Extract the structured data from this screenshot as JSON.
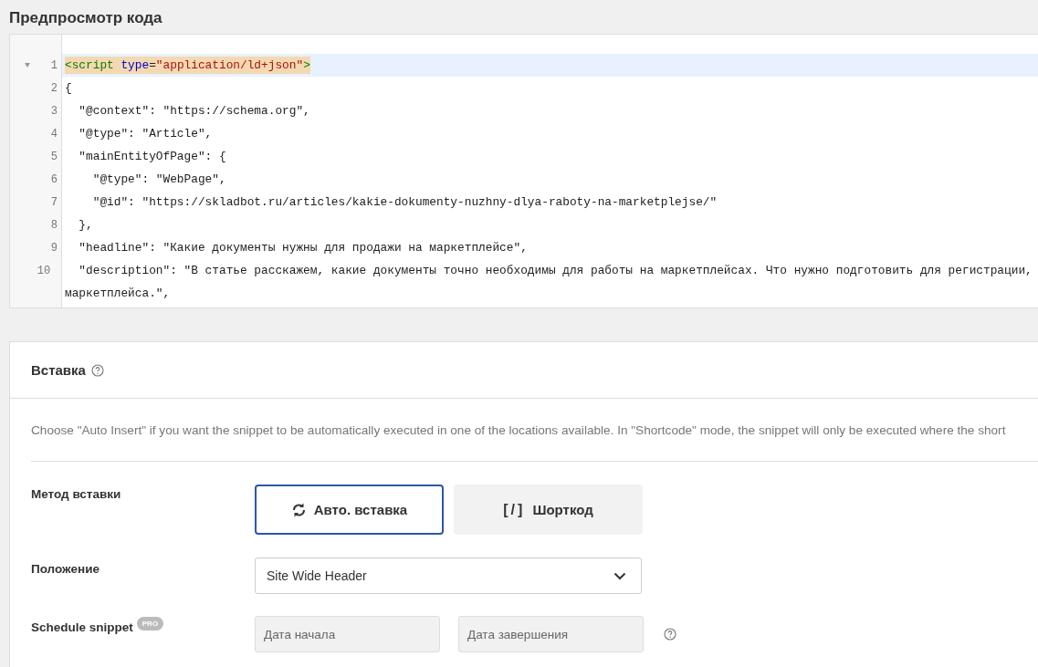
{
  "preview": {
    "title": "Предпросмотр кода",
    "lines": [
      {
        "number": "1",
        "foldable": true,
        "active": true,
        "tokens": [
          {
            "kind": "tag",
            "text": "<script "
          },
          {
            "kind": "attr",
            "text": "type"
          },
          {
            "kind": "plain",
            "text": "="
          },
          {
            "kind": "string",
            "text": "\"application/ld+json\""
          },
          {
            "kind": "tag",
            "text": ">"
          }
        ]
      },
      {
        "number": "2",
        "foldable": false,
        "active": false,
        "text": "{"
      },
      {
        "number": "3",
        "foldable": false,
        "active": false,
        "text": "  \"@context\": \"https://schema.org\","
      },
      {
        "number": "4",
        "foldable": false,
        "active": false,
        "text": "  \"@type\": \"Article\","
      },
      {
        "number": "5",
        "foldable": false,
        "active": false,
        "text": "  \"mainEntityOfPage\": {"
      },
      {
        "number": "6",
        "foldable": false,
        "active": false,
        "text": "    \"@type\": \"WebPage\","
      },
      {
        "number": "7",
        "foldable": false,
        "active": false,
        "text": "    \"@id\": \"https://skladbot.ru/articles/kakie-dokumenty-nuzhny-dlya-raboty-na-marketplejse/\""
      },
      {
        "number": "8",
        "foldable": false,
        "active": false,
        "text": "  },"
      },
      {
        "number": "9",
        "foldable": false,
        "active": false,
        "text": "  \"headline\": \"Какие документы нужны для продажи на маркетплейсе\","
      },
      {
        "number": "10",
        "foldable": false,
        "active": false,
        "text": "  \"description\": \"В статье расскажем, какие документы точно необходимы для работы на маркетплейсах. Что нужно подготовить для регистрации,",
        "wrap": "маркетплейса.\","
      }
    ]
  },
  "insert": {
    "title": "Вставка",
    "description": "Choose \"Auto Insert\" if you want the snippet to be automatically executed in one of the locations available. In \"Shortcode\" mode, the snippet will only be executed where the short",
    "method": {
      "label": "Метод вставки",
      "options": [
        {
          "kind": "auto",
          "label": "Авто. вставка",
          "selected": true
        },
        {
          "kind": "shortcode",
          "glyph": "[/]",
          "label": "Шорткод",
          "selected": false
        }
      ]
    },
    "location": {
      "label": "Положение",
      "value": "Site Wide Header"
    },
    "schedule": {
      "label": "Schedule snippet",
      "badge": "PRO",
      "start": {
        "placeholder": "Дата начала"
      },
      "end": {
        "placeholder": "Дата завершения"
      }
    }
  }
}
